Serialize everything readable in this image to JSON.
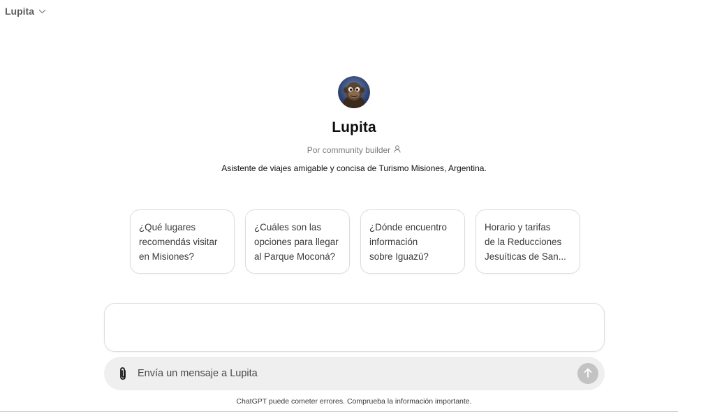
{
  "header": {
    "model_name": "Lupita"
  },
  "gpt": {
    "name": "Lupita",
    "author": "Por community builder",
    "description": "Asistente de viajes amigable y concisa de Turismo Misiones, Argentina."
  },
  "starters": [
    {
      "lines": [
        "¿Qué lugares",
        "recomendás visitar",
        "en Misiones?"
      ]
    },
    {
      "lines": [
        "¿Cuáles son las",
        "opciones para llegar",
        "al Parque Moconá?"
      ]
    },
    {
      "lines": [
        "¿Dónde encuentro",
        "información",
        "sobre Iguazú?"
      ]
    },
    {
      "lines": [
        "Horario y tarifas",
        "de la Reducciones",
        "Jesuíticas de San..."
      ]
    }
  ],
  "composer": {
    "placeholder": "Envía un mensaje a Lupita"
  },
  "disclaimer": "ChatGPT puede cometer errores. Comprueba la información importante.",
  "colors": {
    "send_button_disabled": "#c3c3c3",
    "composer_bg": "#efefef"
  },
  "icons": {
    "model_dropdown": "chevron-down-icon",
    "author": "person-icon",
    "attach": "paperclip-icon",
    "send": "arrow-up-icon"
  }
}
